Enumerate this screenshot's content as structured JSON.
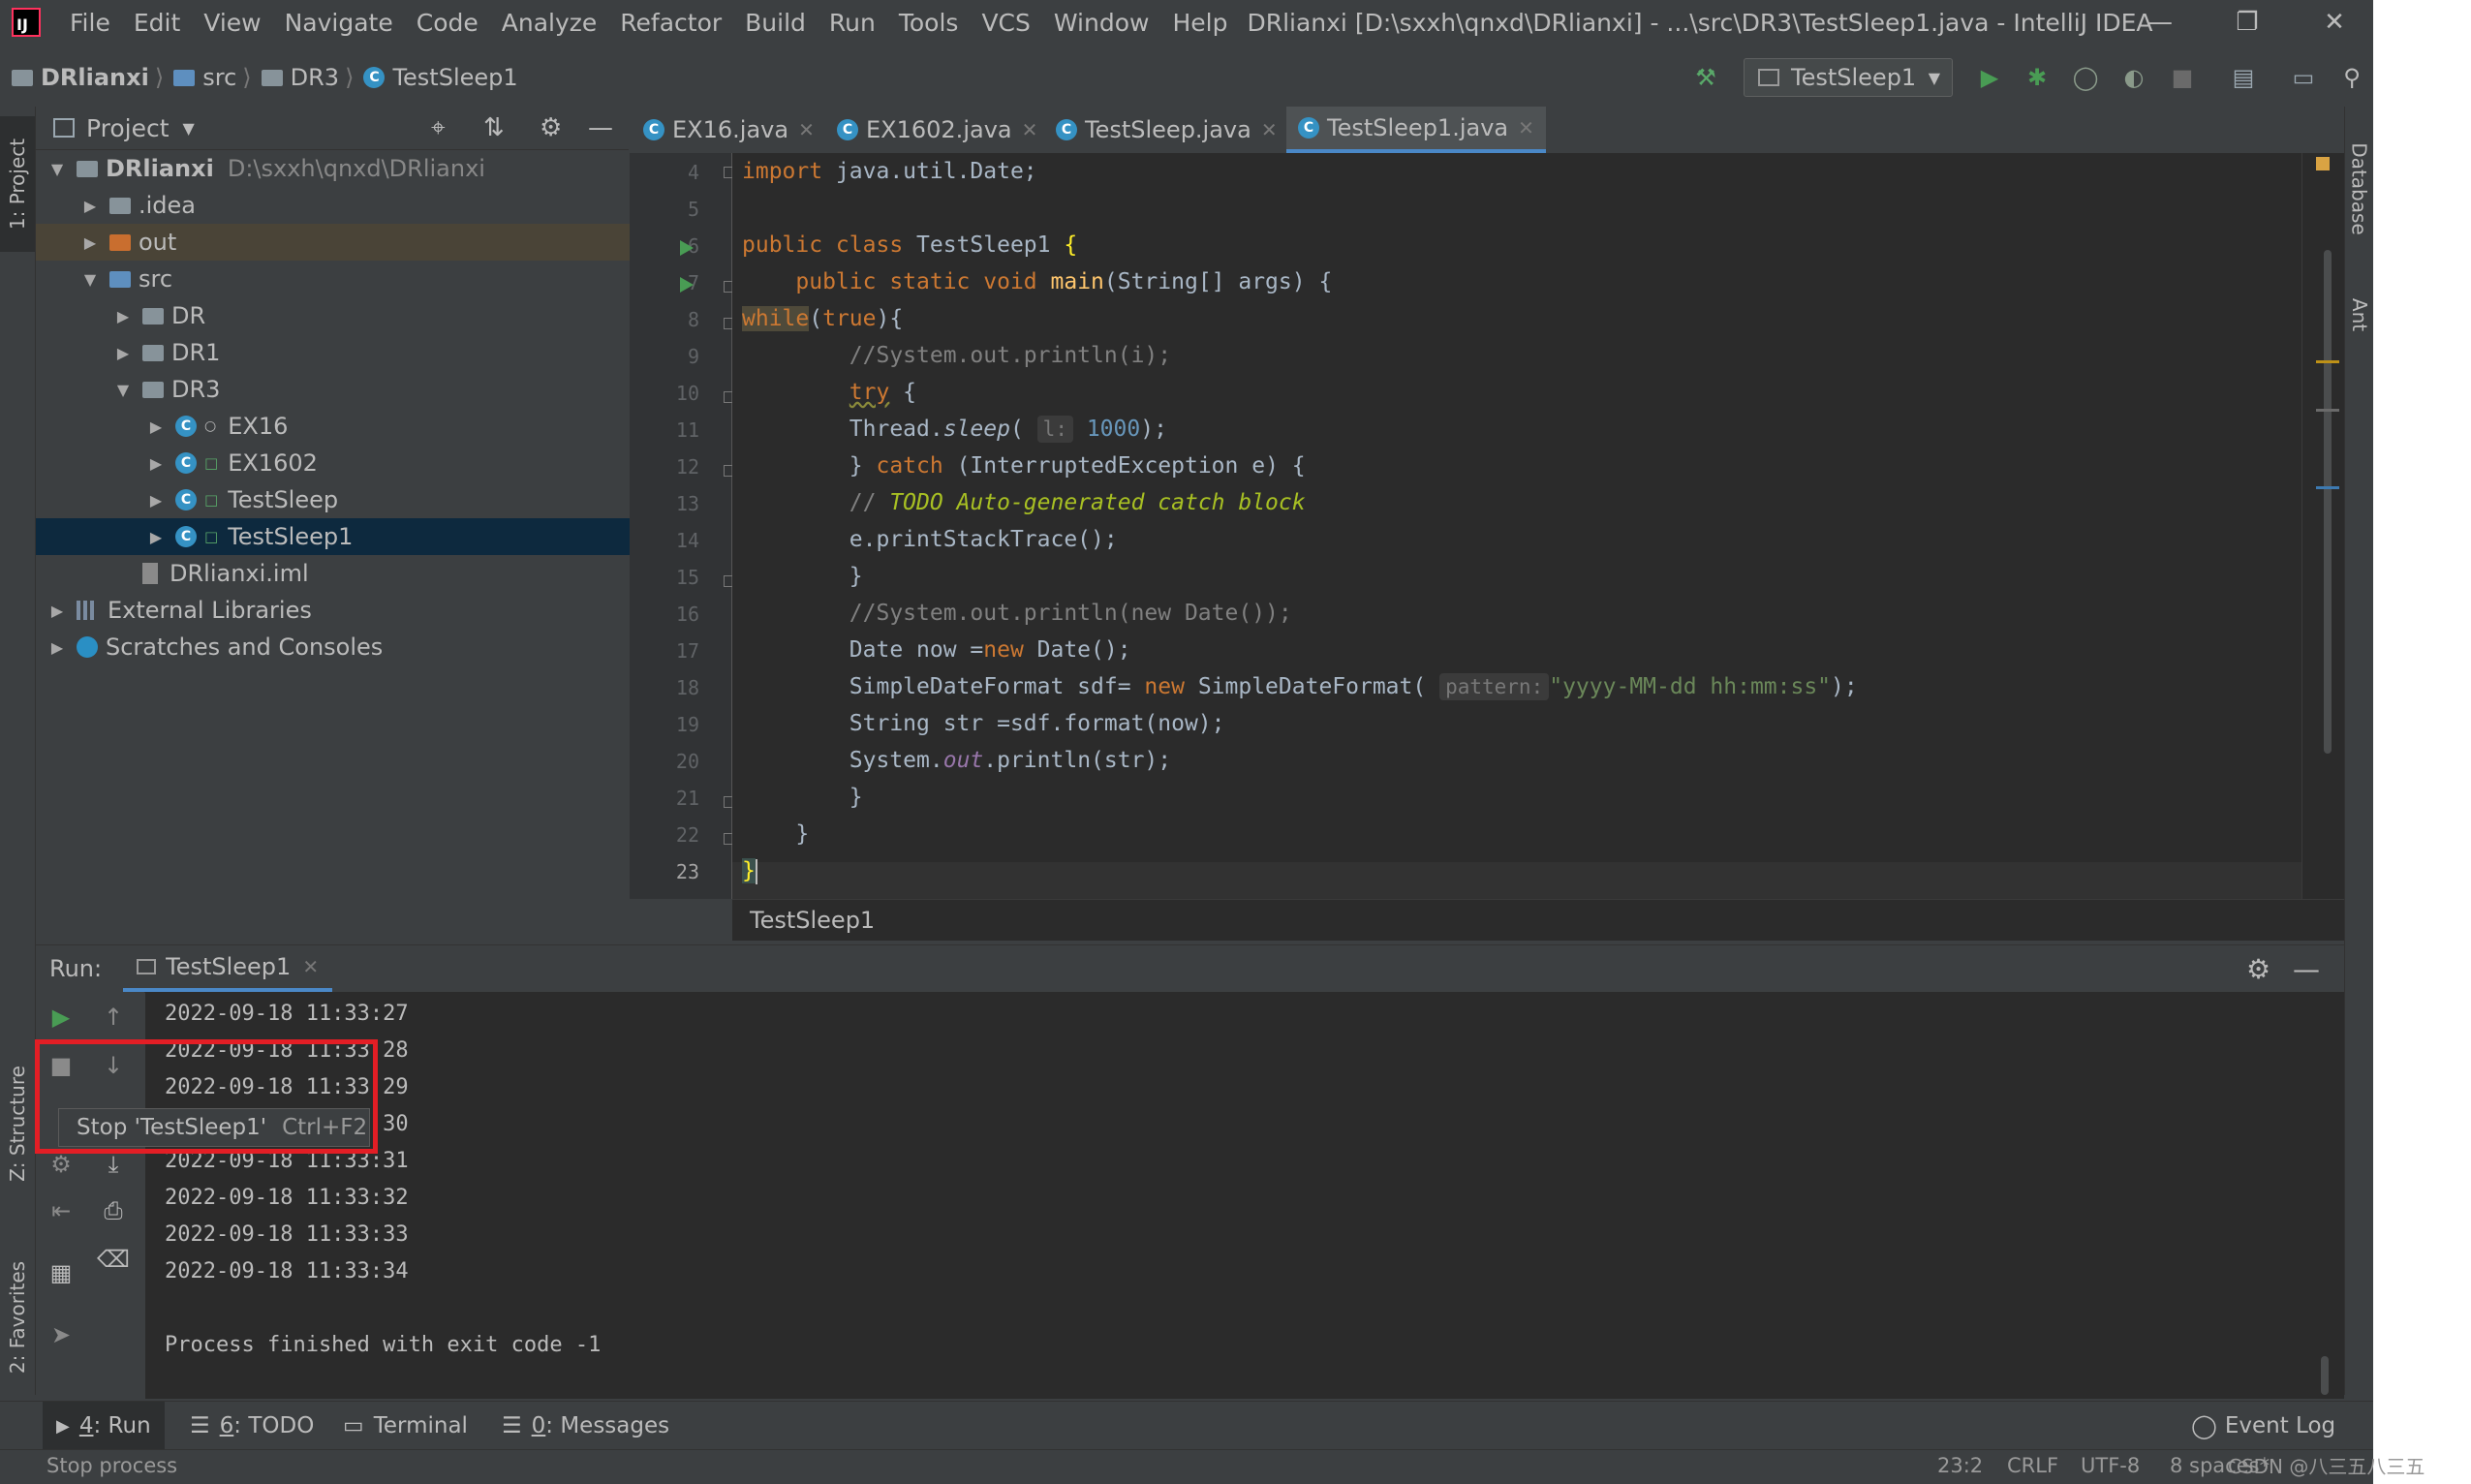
{
  "window": {
    "title": "DRlianxi [D:\\sxxh\\qnxd\\DRlianxi] - ...\\src\\DR3\\TestSleep1.java - IntelliJ IDEA",
    "logo_text": "IJ"
  },
  "menu": [
    "File",
    "Edit",
    "View",
    "Navigate",
    "Code",
    "Analyze",
    "Refactor",
    "Build",
    "Run",
    "Tools",
    "VCS",
    "Window",
    "Help"
  ],
  "navbar": {
    "crumbs": [
      "DRlianxi",
      "src",
      "DR3",
      "TestSleep1"
    ],
    "run_config": "TestSleep1"
  },
  "left_tabs": {
    "project": "1: Project",
    "structure": "Z: Structure",
    "favorites": "2: Favorites"
  },
  "right_tabs": {
    "database": "Database",
    "ant": "Ant"
  },
  "project_panel": {
    "title": "Project",
    "tree": [
      {
        "label": "DRlianxi",
        "path": "D:\\sxxh\\qnxd\\DRlianxi"
      },
      {
        "label": ".idea"
      },
      {
        "label": "out"
      },
      {
        "label": "src"
      },
      {
        "label": "DR"
      },
      {
        "label": "DR1"
      },
      {
        "label": "DR3"
      },
      {
        "label": "EX16"
      },
      {
        "label": "EX1602"
      },
      {
        "label": "TestSleep"
      },
      {
        "label": "TestSleep1"
      },
      {
        "label": "DRlianxi.iml"
      },
      {
        "label": "External Libraries"
      },
      {
        "label": "Scratches and Consoles"
      }
    ]
  },
  "editor": {
    "tabs": [
      "EX16.java",
      "EX1602.java",
      "TestSleep.java",
      "TestSleep1.java"
    ],
    "active_tab": "TestSleep1.java",
    "line_numbers": [
      "4",
      "5",
      "6",
      "7",
      "8",
      "9",
      "10",
      "11",
      "12",
      "13",
      "14",
      "15",
      "16",
      "17",
      "18",
      "19",
      "20",
      "21",
      "22",
      "23"
    ],
    "code": {
      "l4_kw": "import",
      "l4_rest": " java.util.Date;",
      "l6_kw1": "public class",
      "l6_name": " TestSleep1 ",
      "l6_brace": "{",
      "l7_kw": "    public static void ",
      "l7_fn": "main",
      "l7_rest": "(String[] args) {",
      "l8_kw": "while",
      "l8_p1": "(",
      "l8_kw2": "true",
      "l8_p2": "){",
      "l9": "        //System.out.println(i);",
      "l10_kw": "try",
      "l10_rest": " {",
      "l11_a": "        Thread.",
      "l11_fn": "sleep",
      "l11_b": "( ",
      "l11_hint": "l:",
      "l11_num": "1000",
      "l11_c": ");",
      "l12_a": "        } ",
      "l12_kw": "catch",
      "l12_b": " (InterruptedException e) {",
      "l13_a": "        // ",
      "l13_todo": "TODO Auto-generated catch block",
      "l14": "        e.printStackTrace();",
      "l15": "        }",
      "l16": "        //System.out.println(new Date());",
      "l17_a": "        Date now =",
      "l17_kw": "new",
      "l17_b": " Date();",
      "l18_a": "        SimpleDateFormat sdf= ",
      "l18_kw": "new",
      "l18_b": " SimpleDateFormat( ",
      "l18_hint": "pattern:",
      "l18_str": "\"yyyy-MM-dd hh:mm:ss\"",
      "l18_c": ");",
      "l19": "        String str =sdf.format(now);",
      "l20_a": "        System.",
      "l20_fld": "out",
      "l20_b": ".println(str);",
      "l21": "        }",
      "l22": "    }",
      "l23": "}"
    },
    "breadcrumb": "TestSleep1"
  },
  "run_panel": {
    "label": "Run:",
    "tab": "TestSleep1",
    "output": [
      "2022-09-18 11:33:27",
      "2022-09-18 11:33:28",
      "2022-09-18 11:33:29",
      "2022-09-18 11:33:30",
      "2022-09-18 11:33:31",
      "2022-09-18 11:33:32",
      "2022-09-18 11:33:33",
      "2022-09-18 11:33:34",
      "",
      "Process finished with exit code -1"
    ]
  },
  "tooltip": {
    "text": "Stop 'TestSleep1'",
    "shortcut": "Ctrl+F2"
  },
  "tool_windows": [
    {
      "key": "4",
      "label": ": Run"
    },
    {
      "key": "6",
      "label": ": TODO"
    },
    {
      "key": "",
      "label": "Terminal"
    },
    {
      "key": "0",
      "label": ": Messages"
    }
  ],
  "event_log": "Event Log",
  "status": {
    "message": "Stop process",
    "position": "23:2",
    "line_sep": "CRLF",
    "encoding": "UTF-8",
    "indent": "8 spaces*"
  },
  "watermark": "CSDN @八三五八三五",
  "colors": {
    "accent": "#4a88c7",
    "run_green": "#499c54",
    "highlight_red": "#e31e25"
  }
}
